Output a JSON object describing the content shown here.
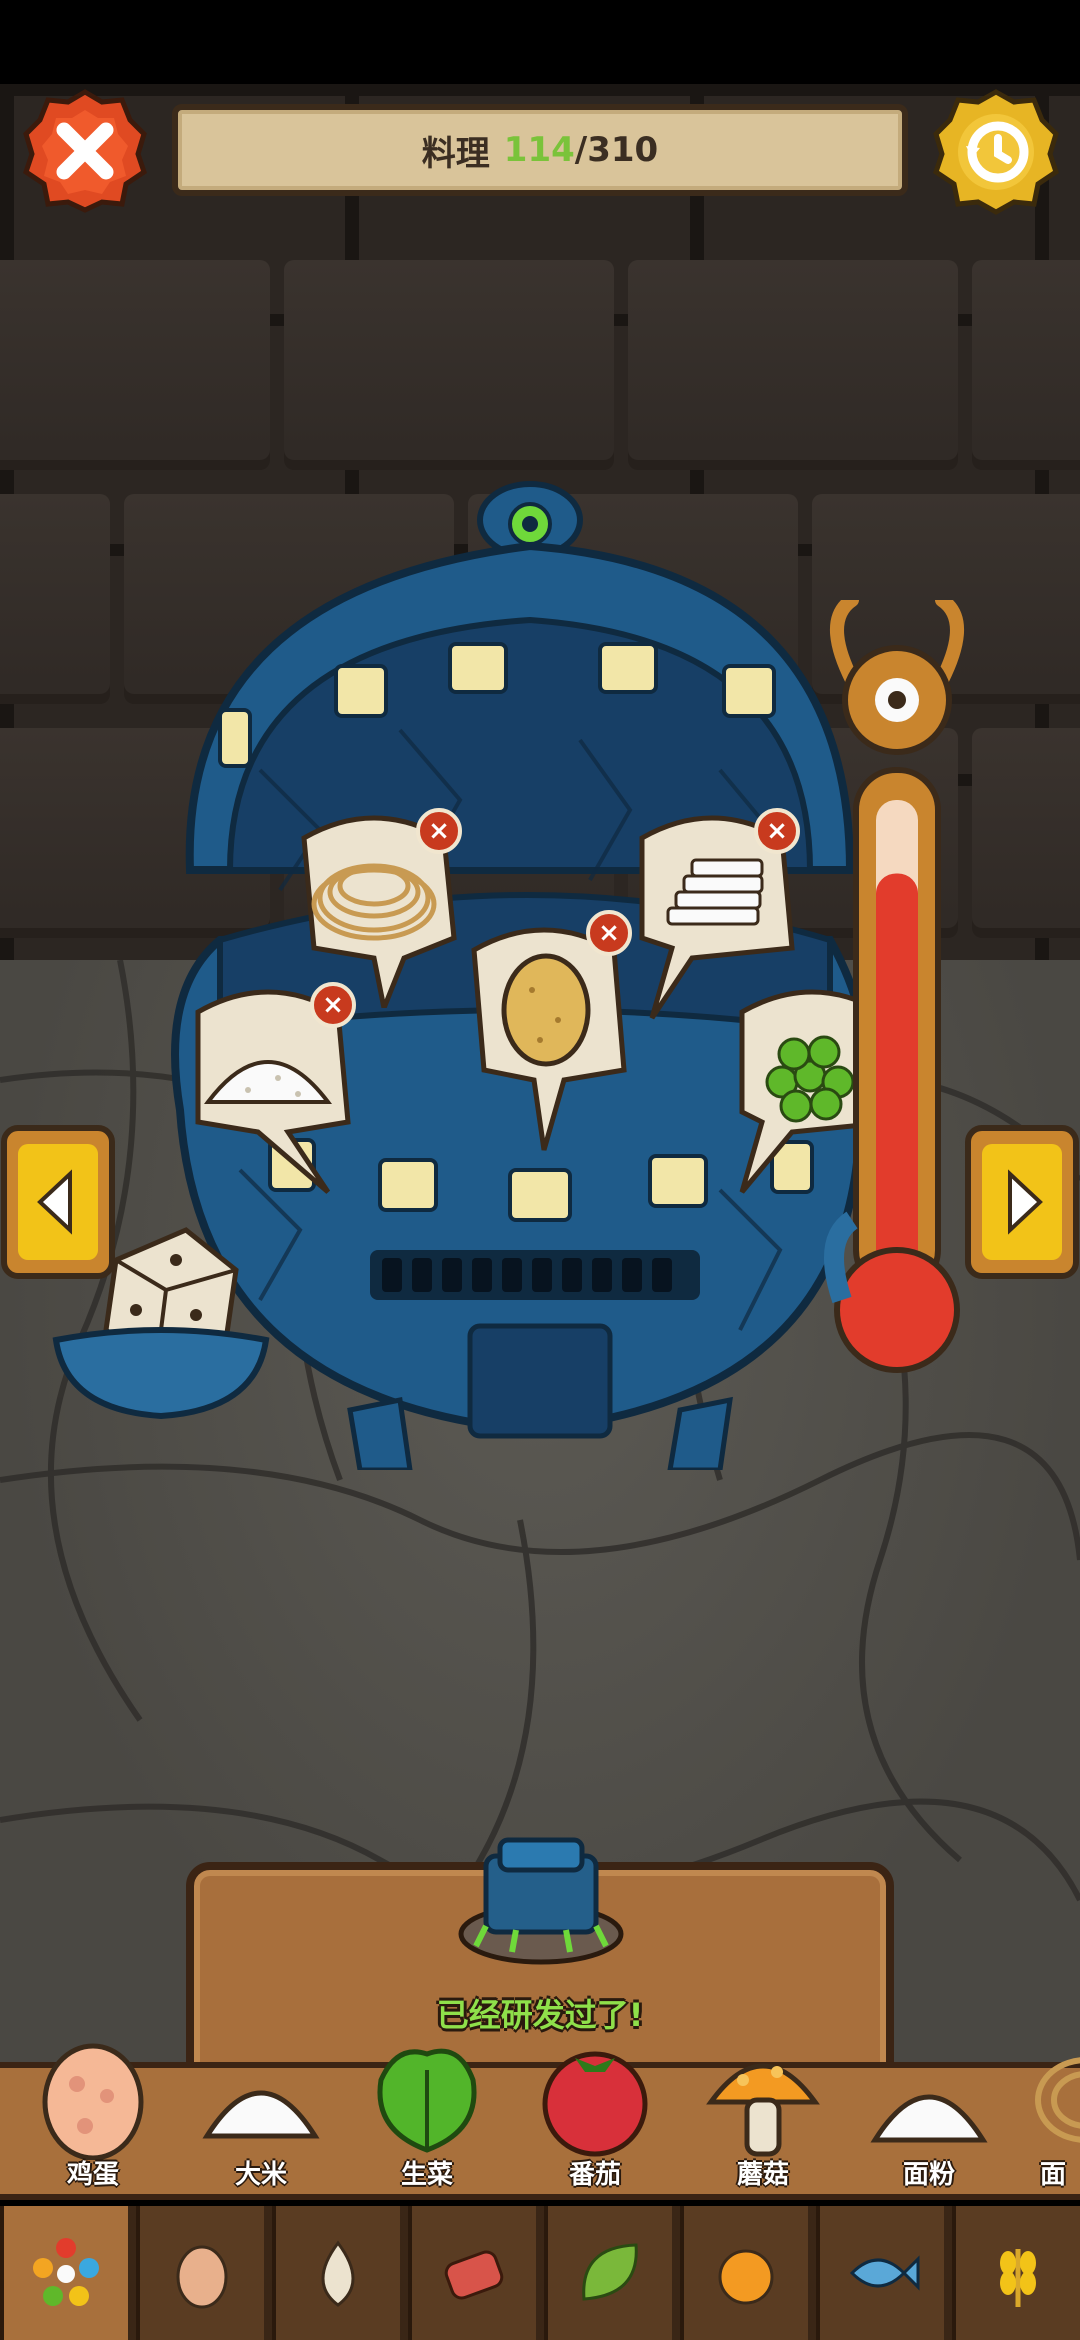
{
  "header": {
    "title_label": "料理",
    "progress_current": "114",
    "progress_sep": "/",
    "progress_total": "310",
    "close_icon": "close-icon",
    "history_icon": "history-clock-icon"
  },
  "cauldron": {
    "selected_ingredients": [
      {
        "name": "noodles",
        "icon": "noodles-icon"
      },
      {
        "name": "potato",
        "icon": "potato-icon"
      },
      {
        "name": "rice-cakes",
        "icon": "rice-cake-icon"
      },
      {
        "name": "flour",
        "icon": "flour-icon"
      },
      {
        "name": "peas",
        "icon": "peas-icon"
      }
    ],
    "heat_level": 0.85
  },
  "result": {
    "status_text": "已经研发过了!"
  },
  "ingredients": [
    {
      "label": "鸡蛋",
      "icon": "egg-icon"
    },
    {
      "label": "大米",
      "icon": "rice-icon"
    },
    {
      "label": "生菜",
      "icon": "lettuce-icon"
    },
    {
      "label": "番茄",
      "icon": "tomato-icon"
    },
    {
      "label": "蘑菇",
      "icon": "mushroom-icon"
    },
    {
      "label": "面粉",
      "icon": "flour-icon"
    },
    {
      "label": "面",
      "icon": "noodles-icon"
    }
  ],
  "categories": [
    {
      "icon": "all-ingredients-icon",
      "active": true
    },
    {
      "icon": "egg-category-icon"
    },
    {
      "icon": "garlic-category-icon"
    },
    {
      "icon": "meat-category-icon"
    },
    {
      "icon": "leaf-category-icon"
    },
    {
      "icon": "fruit-category-icon"
    },
    {
      "icon": "fish-category-icon"
    },
    {
      "icon": "grain-category-icon"
    }
  ],
  "colors": {
    "progress_current": "#7ac33a",
    "status_text": "#8fe04a",
    "cauldron_blue": "#1f5b8a",
    "thermometer_red": "#e23c2c"
  }
}
